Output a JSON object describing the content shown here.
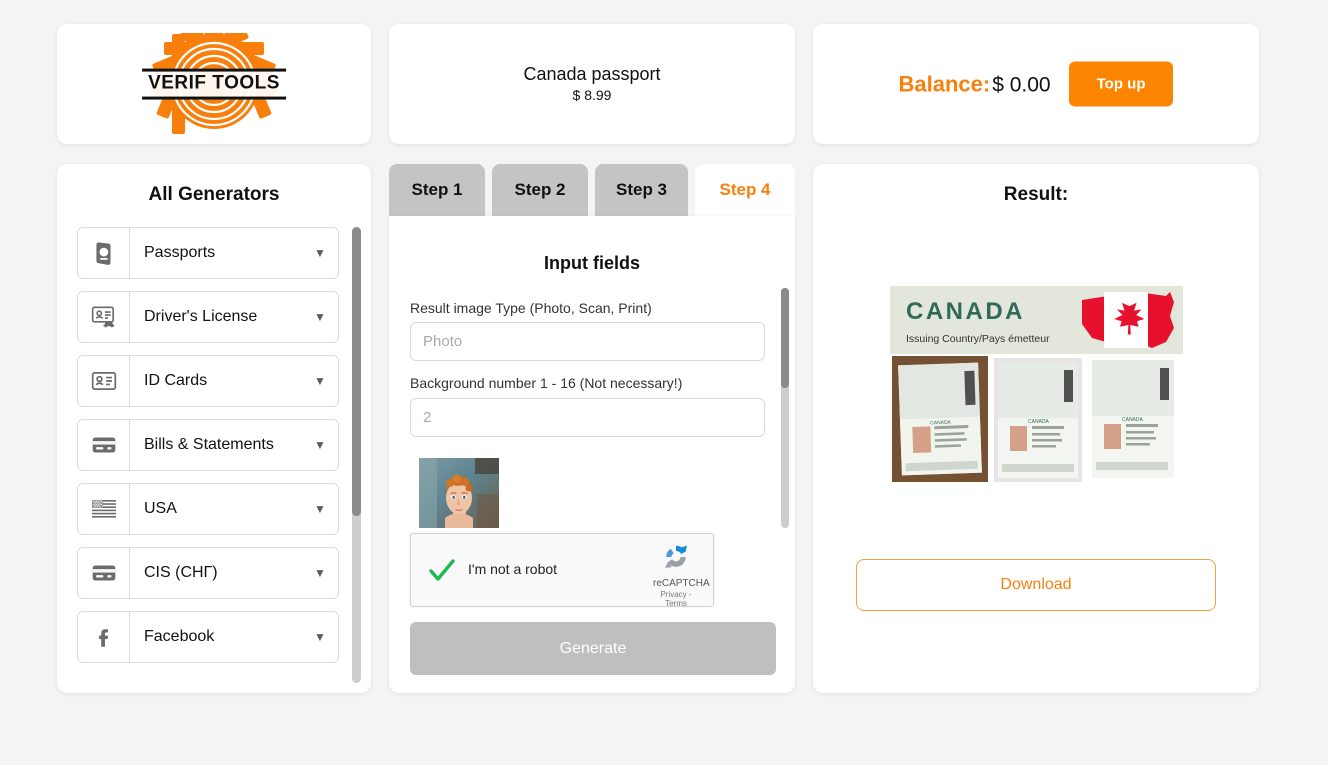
{
  "brand": {
    "logo_text_line1": "VERIF TOOLS",
    "logo_icon": "gear-icon"
  },
  "document": {
    "title": "Canada passport",
    "price": "$ 8.99"
  },
  "account": {
    "balance_label": "Balance:",
    "balance_amount": "$ 0.00",
    "topup_label": "Top up"
  },
  "sidebar": {
    "title": "All Generators",
    "items": [
      {
        "label": "Passports",
        "icon": "passport-icon",
        "caret": "▼"
      },
      {
        "label": "Driver's License",
        "icon": "drivers-license-icon",
        "caret": "▼"
      },
      {
        "label": "ID Cards",
        "icon": "id-card-icon",
        "caret": "▼"
      },
      {
        "label": "Bills & Statements",
        "icon": "credit-card-icon",
        "caret": "▼"
      },
      {
        "label": "USA",
        "icon": "usa-flag-icon",
        "caret": "▼"
      },
      {
        "label": "CIS (СНГ)",
        "icon": "credit-card-icon",
        "caret": "▼"
      },
      {
        "label": "Facebook",
        "icon": "facebook-icon",
        "caret": "▼"
      }
    ]
  },
  "steps": {
    "tabs": [
      {
        "label": "Step 1",
        "active": false
      },
      {
        "label": "Step 2",
        "active": false
      },
      {
        "label": "Step 3",
        "active": false
      },
      {
        "label": "Step 4",
        "active": true
      }
    ]
  },
  "form": {
    "heading": "Input fields",
    "fields": [
      {
        "label": "Result image Type (Photo, Scan, Print)",
        "value": "",
        "placeholder": "Photo"
      },
      {
        "label": "Background number 1 - 16 (Not necessary!)",
        "value": "",
        "placeholder": "2"
      }
    ],
    "photo_preview_alt": "uploaded-portrait-photo",
    "recaptcha": {
      "text": "I'm not a robot",
      "checked": true,
      "brand": "reCAPTCHA",
      "links": "Privacy - Terms"
    },
    "generate_label": "Generate",
    "generate_disabled": true
  },
  "result": {
    "title": "Result:",
    "preview": {
      "country": "CANADA",
      "subtitle": "Issuing Country/Pays émetteur",
      "flag": "canada-maple-leaf"
    },
    "download_label": "Download"
  },
  "colors": {
    "accent_orange": "#F97F0D",
    "button_orange": "#FB8500",
    "page_bg": "#f4f4f4",
    "card_bg": "#ffffff",
    "tab_inactive_bg": "#c4c4c4",
    "disabled_gray": "#bfbfbf",
    "scrollbar_thumb": "#8a8a8a",
    "scrollbar_track": "#cdcdcd"
  }
}
